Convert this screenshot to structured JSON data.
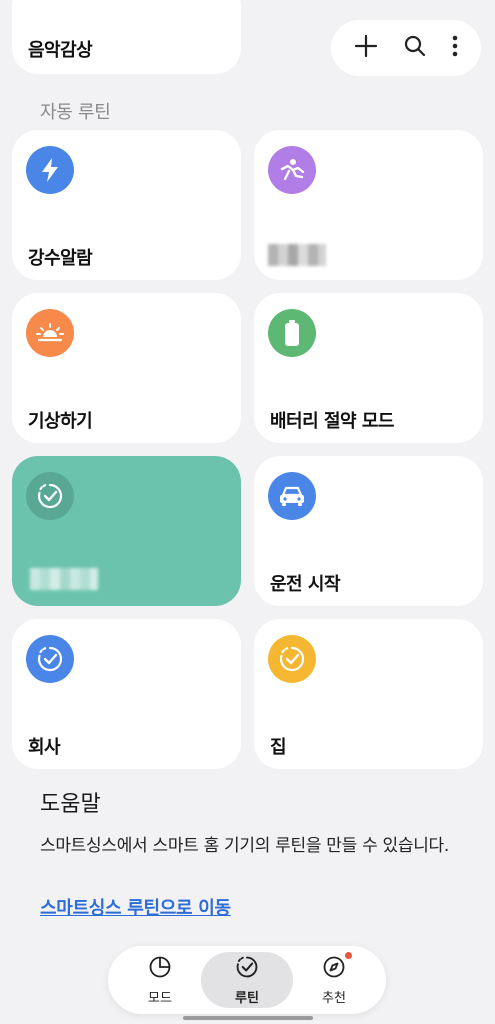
{
  "top_card": {
    "label": "음악감상"
  },
  "toolbar": {
    "add_icon": "plus-icon",
    "search_icon": "search-icon",
    "more_icon": "more-vertical-icon"
  },
  "section_title": "자동 루틴",
  "routines": [
    {
      "label": "강수알람",
      "icon": "lightning-icon",
      "color": "#4a86e8"
    },
    {
      "label": "",
      "icon": "running-person-icon",
      "color": "#b07ee6",
      "label_obscured": true
    },
    {
      "label": "기상하기",
      "icon": "sunrise-icon",
      "color": "#f7894b"
    },
    {
      "label": "배터리 절약 모드",
      "icon": "battery-icon",
      "color": "#5cb873"
    },
    {
      "label": "",
      "icon": "routine-check-icon",
      "color": "#6cc3ad",
      "label_obscured": true
    },
    {
      "label": "운전 시작",
      "icon": "car-icon",
      "color": "#4a86e8"
    },
    {
      "label": "회사",
      "icon": "routine-check-icon",
      "color": "#4a86e8"
    },
    {
      "label": "집",
      "icon": "routine-check-icon",
      "color": "#f5b731"
    }
  ],
  "help": {
    "title": "도움말",
    "body": "스마트싱스에서 스마트 홈 기기의 루틴을 만들 수 있습니다.",
    "link": "스마트싱스 루틴으로 이동"
  },
  "bottom_nav": {
    "items": [
      {
        "label": "모드",
        "icon": "mode-pie-icon",
        "active": false
      },
      {
        "label": "루틴",
        "icon": "routine-check-icon",
        "active": true
      },
      {
        "label": "추천",
        "icon": "compass-icon",
        "active": false,
        "badge": true
      }
    ]
  },
  "colors": {
    "accent": "#2b6cd6",
    "badge": "#e8553a"
  }
}
